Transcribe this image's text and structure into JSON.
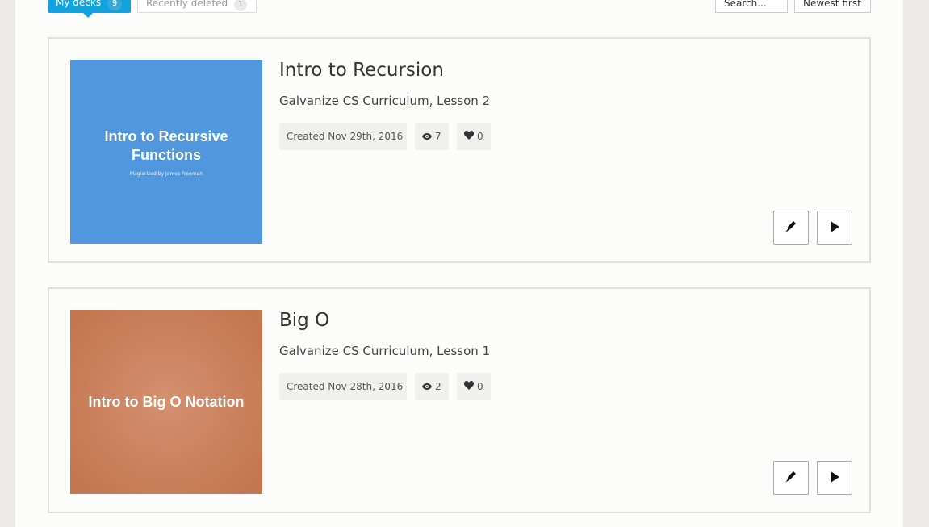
{
  "tabs": {
    "my_decks": {
      "label": "My decks",
      "count": "9"
    },
    "recently_deleted": {
      "label": "Recently deleted",
      "count": "1"
    }
  },
  "search": {
    "placeholder": "Search..."
  },
  "sort": {
    "label": "Newest first"
  },
  "decks": [
    {
      "thumbnail_title": "Intro to Recursive Functions",
      "thumbnail_subtitle": "Plagiarized by James Freeman",
      "title": "Intro to Recursion",
      "description": "Galvanize CS Curriculum, Lesson 2",
      "created": "Created Nov 29th, 2016",
      "views": "7",
      "likes": "0",
      "thumbnail_color": "#5097dd"
    },
    {
      "thumbnail_title": "Intro to Big O Notation",
      "title": "Big O",
      "description": "Galvanize CS Curriculum, Lesson 1",
      "created": "Created Nov 28th, 2016",
      "views": "2",
      "likes": "0",
      "thumbnail_color": "#c47650"
    }
  ],
  "icons": [
    "eye-icon",
    "heart-icon",
    "pencil-icon",
    "play-icon"
  ]
}
